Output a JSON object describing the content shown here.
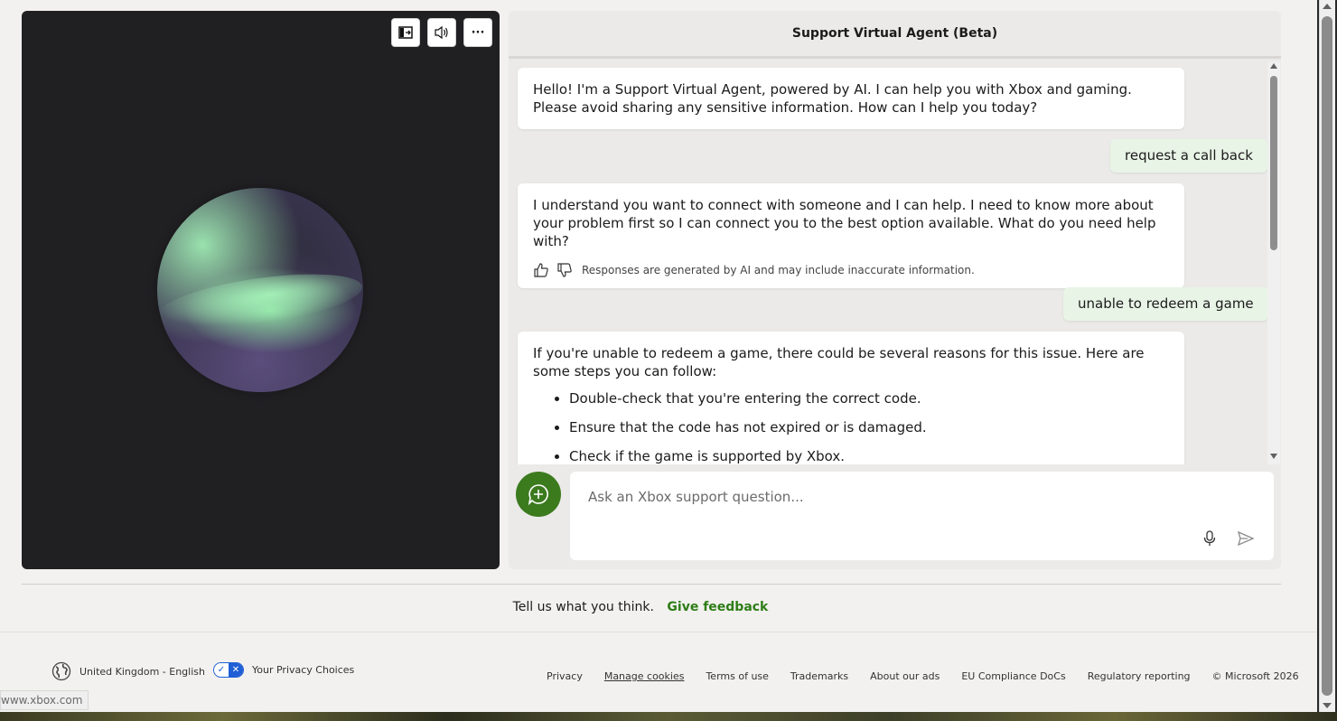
{
  "avatar_controls": {
    "panel_toggle_icon": "panel-expand-icon",
    "sound_icon": "speaker-icon",
    "more_label": "···"
  },
  "chat": {
    "title": "Support Virtual Agent (Beta)",
    "messages": [
      {
        "role": "bot",
        "text": "Hello! I'm a Support Virtual Agent, powered by AI. I can help you with Xbox and gaming. Please avoid sharing any sensitive information. How can I help you today?"
      },
      {
        "role": "user",
        "text": "request a call back"
      },
      {
        "role": "bot",
        "text": "I understand you want to connect with someone and I can help. I need to know more about your problem first so I can connect you to the best option available. What do you need help with?",
        "disclaimer": "Responses are generated by AI and may include inaccurate information."
      },
      {
        "role": "user",
        "text": "unable to redeem a game"
      },
      {
        "role": "bot",
        "text": "If you're unable to redeem a game, there could be several reasons for this issue. Here are some steps you can follow:",
        "bullets": [
          "Double-check that you're entering the correct code.",
          "Ensure that the code has not expired or is damaged.",
          "Check if the game is supported by Xbox."
        ]
      }
    ],
    "input_placeholder": "Ask an Xbox support question..."
  },
  "feedback": {
    "prompt": "Tell us what you think.",
    "link": "Give feedback"
  },
  "footer": {
    "locale": "United Kingdom - English",
    "privacy_choices": "Your Privacy Choices",
    "links": [
      "Privacy",
      "Manage cookies",
      "Terms of use",
      "Trademarks",
      "About our ads",
      "EU Compliance DoCs",
      "Regulatory reporting",
      "© Microsoft 2026"
    ]
  },
  "status_url": "www.xbox.com",
  "colors": {
    "accent_green": "#3c7a1e",
    "link_green": "#2e7d17",
    "user_bubble": "#e8f4e6",
    "avatar_bg": "#201f22"
  }
}
